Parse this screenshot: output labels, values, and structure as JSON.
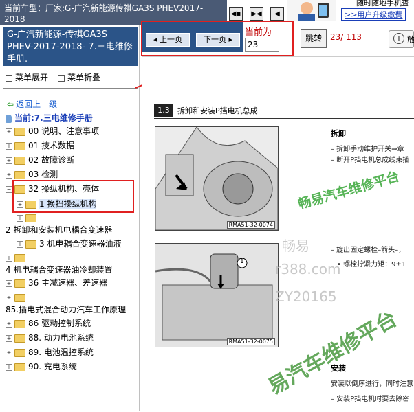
{
  "window": {
    "current_model_label": "当前车型：厂家:G-广汽新能源传祺GA3S PHEV2017-2018"
  },
  "nav_icons": [
    "first-page-icon",
    "double-arrow-icon",
    "last-page-icon"
  ],
  "ad": {
    "line1": "随时随地手机查",
    "line2": ">>用户升级缴费"
  },
  "manual": {
    "title": "G-广汽新能源-传祺GA3S PHEV-2017-2018- 7.三电维修手册.",
    "expand_label": "菜单展开",
    "collapse_label": "菜单折叠",
    "back_link": "返回上一级",
    "current_label": "当前:7.三电维修手册"
  },
  "tree": [
    {
      "label": "00 说明、注意事项"
    },
    {
      "label": "01 技术数据"
    },
    {
      "label": "02 故障诊断"
    },
    {
      "label": "03 检测"
    },
    {
      "label": "32 操纵机构、壳体"
    },
    {
      "label": "1 换挡操纵机构"
    },
    {
      "label": ""
    },
    {
      "label": "2 拆卸和安装机电耦合变速器"
    },
    {
      "label": "3 机电耦合变速器油液"
    },
    {
      "label": ""
    },
    {
      "label": "4 机电耦合变速器油冷却装置"
    },
    {
      "label": "36 主减速器、差速器"
    },
    {
      "label": ""
    },
    {
      "label": "85.插电式混合动力汽车工作原理"
    },
    {
      "label": "86 驱动控制系统"
    },
    {
      "label": "88. 动力电池系统"
    },
    {
      "label": "89. 电池温控系统"
    },
    {
      "label": "90. 充电系统"
    }
  ],
  "toolbar": {
    "prev_label": "上一页",
    "next_label": "下一页",
    "current_page_label": "当前为",
    "page_value": "23",
    "jump_label": "跳转",
    "page_count": "23/ 113",
    "zoom_label": "放"
  },
  "document": {
    "section_number": "1.3",
    "section_title": "拆卸和安装P挡电机总成",
    "photo1_label": "RMA51-32-0074",
    "photo2_label": "RMA51-32-0075",
    "photo2_callout": "1",
    "right_texts": [
      "拆卸",
      "–  拆卸手动维护开关⇒章",
      "–  断开P挡电机总成线束插",
      "–  旋出固定螺栓–箭头–，",
      "•  螺栓拧紧力矩：9±1",
      "安装",
      "安装以倒序进行，同时注意",
      "–  安装P挡电机时要去除密"
    ]
  },
  "watermarks": {
    "green1": "畅易汽车维修平台",
    "green2": "易汽车维修平台",
    "gray1": "畅易",
    "gray2": "r388.com",
    "gray3": "ZY20165"
  },
  "colors": {
    "header_blue": "#2b5488",
    "highlight_red": "#e02020",
    "watermark_green": "#3aa83a",
    "link_blue": "#1a5fd0"
  }
}
